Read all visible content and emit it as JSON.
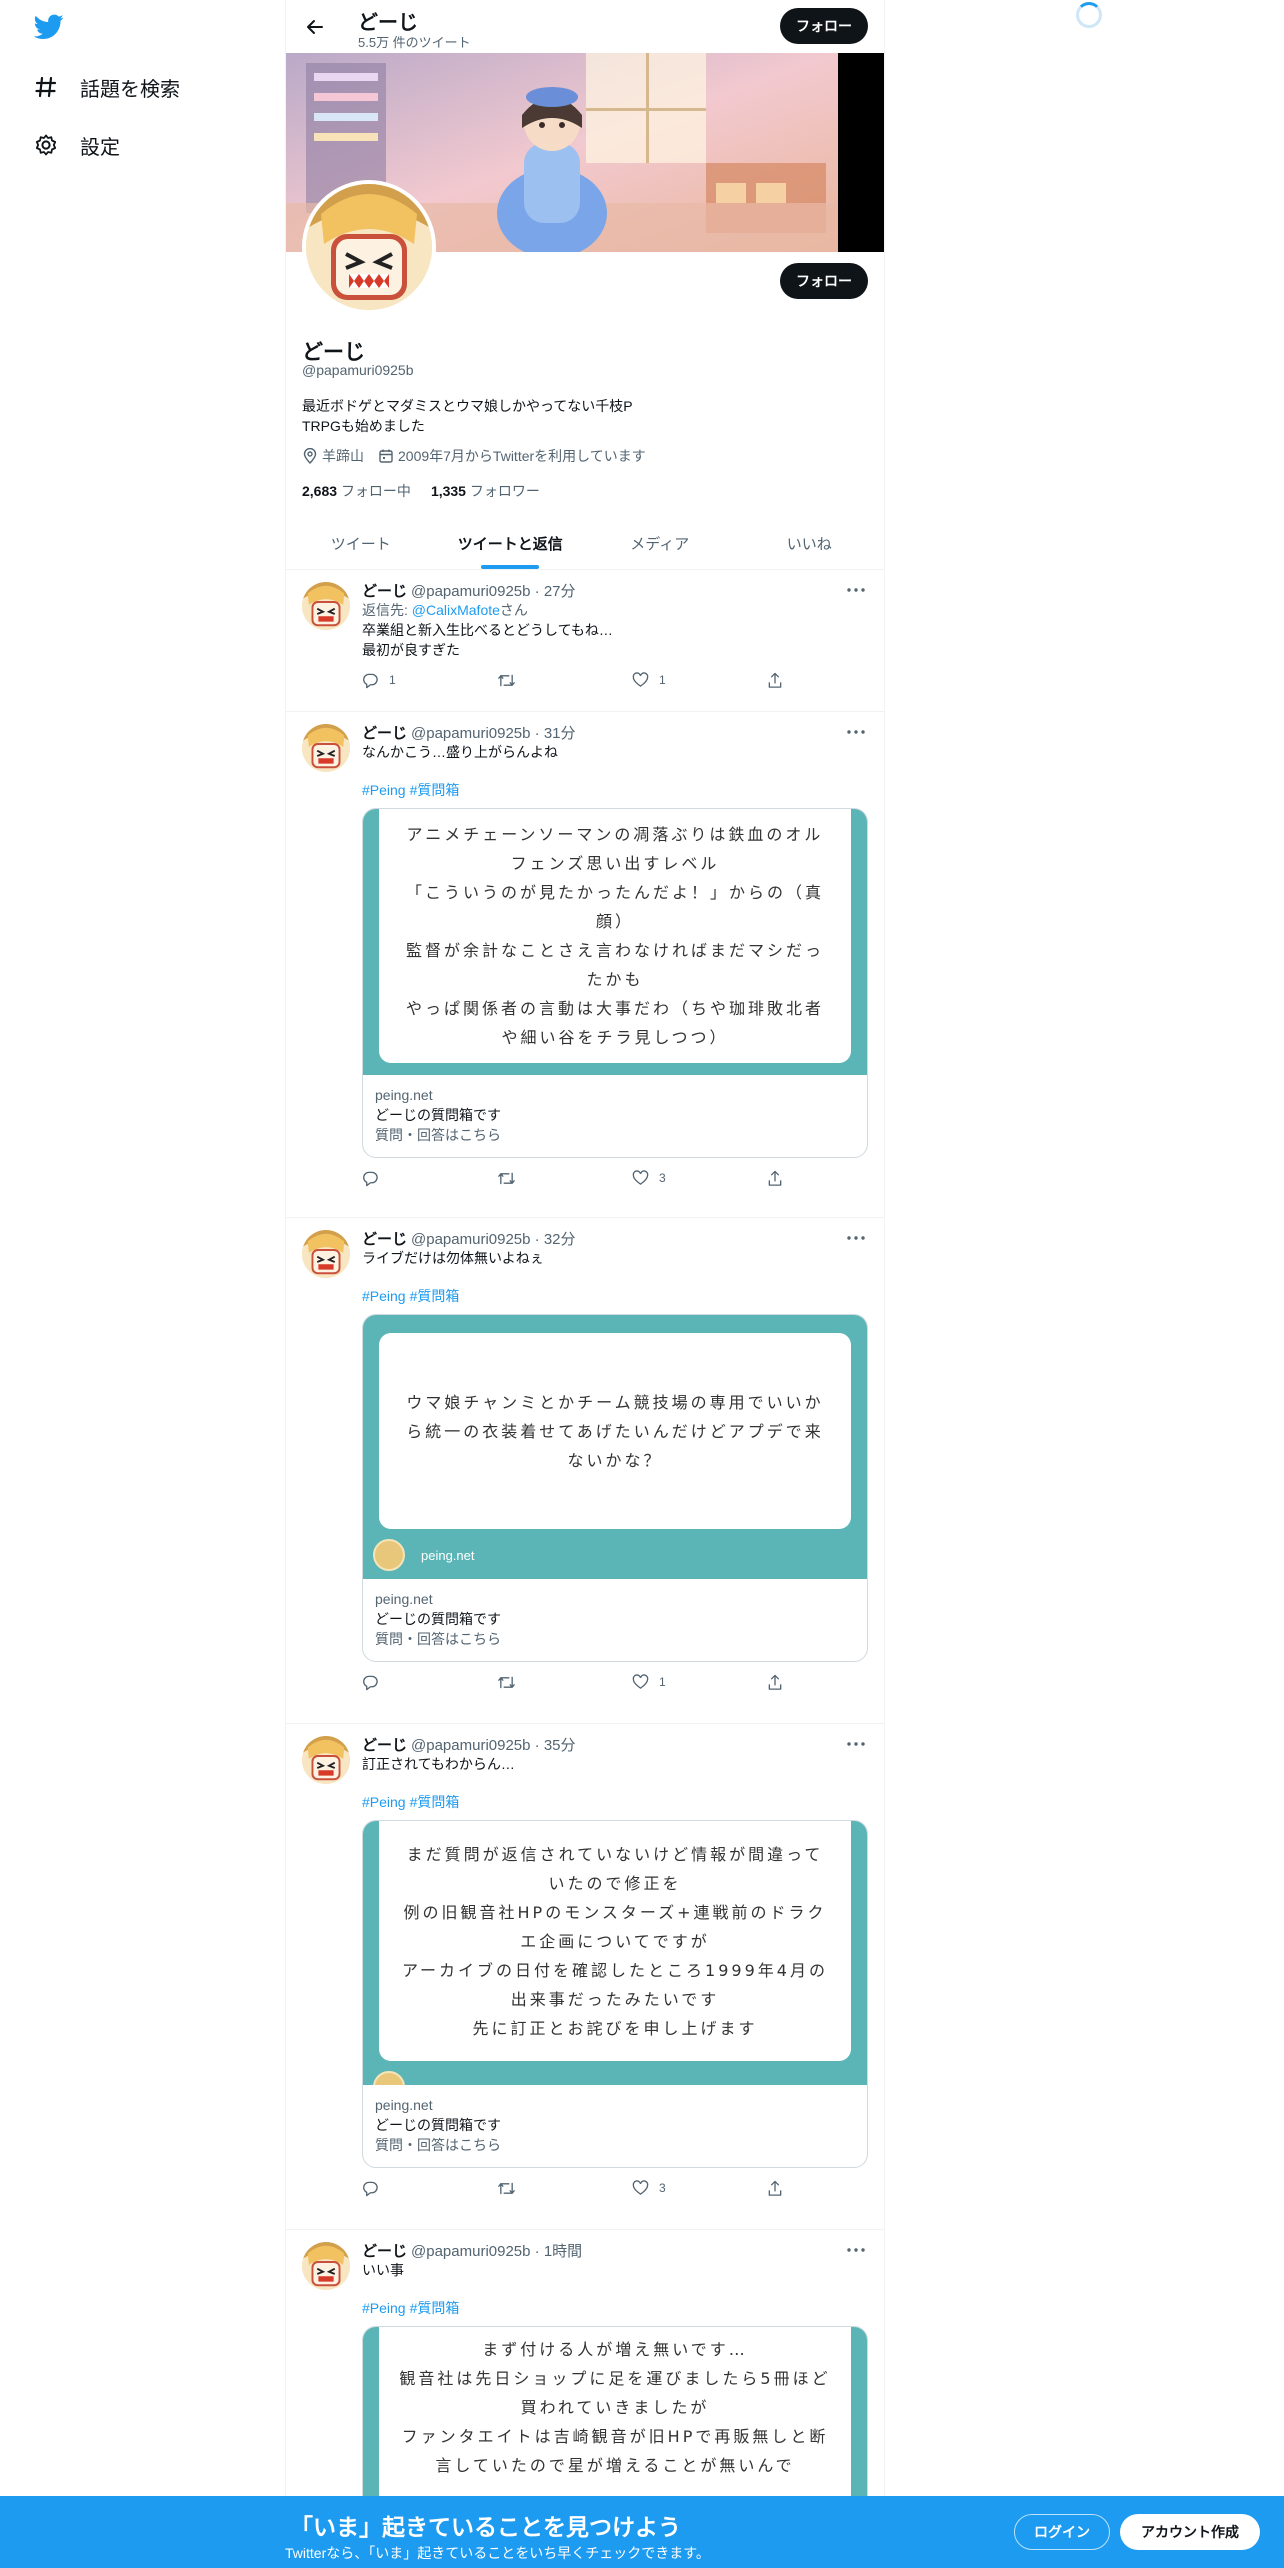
{
  "nav": {
    "items": [
      {
        "label": "話題を検索",
        "icon": "hashtag-icon"
      },
      {
        "label": "設定",
        "icon": "gear-icon"
      }
    ]
  },
  "colors": {
    "accent": "#1d9bf0",
    "text": "#0f1419",
    "muted": "#536471",
    "card_teal": "#5bb5b6"
  },
  "topbar": {
    "name": "どーじ",
    "tweet_count": "5.5万 件のツイート",
    "follow_label": "フォロー"
  },
  "profile": {
    "name": "どーじ",
    "handle": "@papamuri0925b",
    "bio_line1": "最近ボドゲとマダミスとウマ娘しかやってない千枝P",
    "bio_line2": "TRPGも始めました",
    "location": "羊蹄山",
    "joined": "2009年7月からTwitterを利用しています",
    "following_count": "2,683",
    "following_label": "フォロー中",
    "followers_count": "1,335",
    "followers_label": "フォロワー",
    "follow_label": "フォロー"
  },
  "tabs": [
    "ツイート",
    "ツイートと返信",
    "メディア",
    "いいね"
  ],
  "tweets": [
    {
      "name": "どーじ",
      "meta": "@papamuri0925b · 27分",
      "reply_prefix": "返信先: ",
      "reply_to": "@CalixMafote",
      "reply_suffix": "さん",
      "text": "卒業組と新入生比べるとどうしてもね…\n最初が良すぎた",
      "reply_count": "1",
      "retweet_count": "",
      "like_count": "1"
    },
    {
      "name": "どーじ",
      "meta": "@papamuri0925b · 31分",
      "text": "なんかこう…盛り上がらんよね",
      "tags": [
        "#Peing",
        "#質問箱"
      ],
      "card_image_text": "アニメチェーンソーマンの凋落ぶりは鉄血のオルフェンズ思い出すレベル\n「こういうのが見たかったんだよ！」からの（真顔）\n監督が余計なことさえ言わなければまだマシだったかも\nやっぱ関係者の言動は大事だわ（ちや珈琲敗北者や細い谷をチラ見しつつ）",
      "card_domain": "peing.net",
      "card_title": "どーじの質問箱です",
      "card_desc": "質問・回答はこちら",
      "reply_count": "",
      "retweet_count": "",
      "like_count": "3"
    },
    {
      "name": "どーじ",
      "meta": "@papamuri0925b · 32分",
      "text": "ライブだけは勿体無いよねぇ",
      "tags": [
        "#Peing",
        "#質問箱"
      ],
      "card_image_text": "ウマ娘チャンミとかチーム競技場の専用でいいから統一の衣装着せてあげたいんだけどアプデで来ないかな？",
      "card_image_site": "peing.net",
      "card_domain": "peing.net",
      "card_title": "どーじの質問箱です",
      "card_desc": "質問・回答はこちら",
      "reply_count": "",
      "retweet_count": "",
      "like_count": "1"
    },
    {
      "name": "どーじ",
      "meta": "@papamuri0925b · 35分",
      "text": "訂正されてもわからん…",
      "tags": [
        "#Peing",
        "#質問箱"
      ],
      "card_image_text": "まだ質問が返信されていないけど情報が間違っていたので修正を\n例の旧観音社HPのモンスターズ+連戦前のドラクエ企画についてですが\nアーカイブの日付を確認したところ1999年4月の出来事だったみたいです\n先に訂正とお詫びを申し上げます",
      "card_domain": "peing.net",
      "card_title": "どーじの質問箱です",
      "card_desc": "質問・回答はこちら",
      "reply_count": "",
      "retweet_count": "",
      "like_count": "3"
    },
    {
      "name": "どーじ",
      "meta": "@papamuri0925b · 1時間",
      "text": "いい事",
      "tags": [
        "#Peing",
        "#質問箱"
      ],
      "card_image_text": "まず付ける人が増え無いです…\n観音社は先日ショップに足を運びましたら5冊ほど買われていきましたが\nファンタエイトは吉崎観音が旧HPで再販無しと断言していたので星が増えることが無いんで"
    }
  ],
  "bottom": {
    "title": "「いま」起きていることを見つけよう",
    "subtitle": "Twitterなら、「いま」起きていることをいち早くチェックできます。",
    "login_label": "ログイン",
    "signup_label": "アカウント作成"
  }
}
